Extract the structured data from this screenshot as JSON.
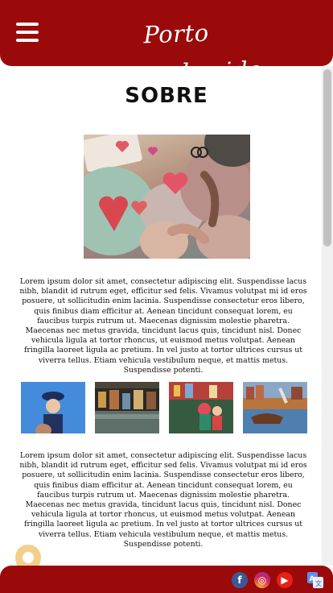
{
  "header": {
    "menu_icon": "hamburger-menu-icon",
    "logo_text": "Porto Desconhecido",
    "background_color": "#9b0a0a"
  },
  "page": {
    "title": "SOBRE",
    "paragraph_1": "Lorem ipsum dolor sit amet, consectetur adipiscing elit. Suspendisse lacus nibh, blandit id rutrum eget, efficitur sed felis. Vivamus volutpat mi id eros posuere, ut sollicitudin enim lacinia. Suspendisse consectetur eros libero, quis finibus diam efficitur at. Aenean tincidunt consequat lorem, eu faucibus turpis rutrum ut. Maecenas dignissim molestie pharetra. Maecenas nec metus gravida, tincidunt lacus quis, tincidunt nisl. Donec vehicula ligula at tortor rhoncus, ut euismod metus volutpat. Aenean fringilla laoreet ligula ac pretium. In vel justo at tortor ultrices cursus ut viverra tellus. Etiam vehicula vestibulum neque, et mattis metus. Suspendisse potenti.",
    "paragraph_2": "Lorem ipsum dolor sit amet, consectetur adipiscing elit. Suspendisse lacus nibh, blandit id rutrum eget, efficitur sed felis. Vivamus volutpat mi id eros posuere, ut sollicitudin enim lacinia. Suspendisse consectetur eros libero, quis finibus diam efficitur at. Aenean tincidunt consequat lorem, eu faucibus turpis rutrum ut. Maecenas dignissim molestie pharetra. Maecenas nec metus gravida, tincidunt lacus quis, tincidunt nisl. Donec vehicula ligula at tortor rhoncus, ut euismod metus volutpat. Aenean fringilla laoreet ligula ac pretium. In vel justo at tortor ultrices cursus ut viverra tellus. Etiam vehicula vestibulum neque, et mattis metus. Suspendisse potenti."
  },
  "footer": {
    "social": [
      {
        "icon": "facebook-icon",
        "glyph": "f",
        "color": "#3b5998"
      },
      {
        "icon": "instagram-icon",
        "glyph": "◎",
        "color": "#cc2366"
      },
      {
        "icon": "youtube-icon",
        "glyph": "▶",
        "color": "#e62117"
      }
    ],
    "translate_icon": "translate-icon",
    "location_icon": "location-pin-icon"
  }
}
